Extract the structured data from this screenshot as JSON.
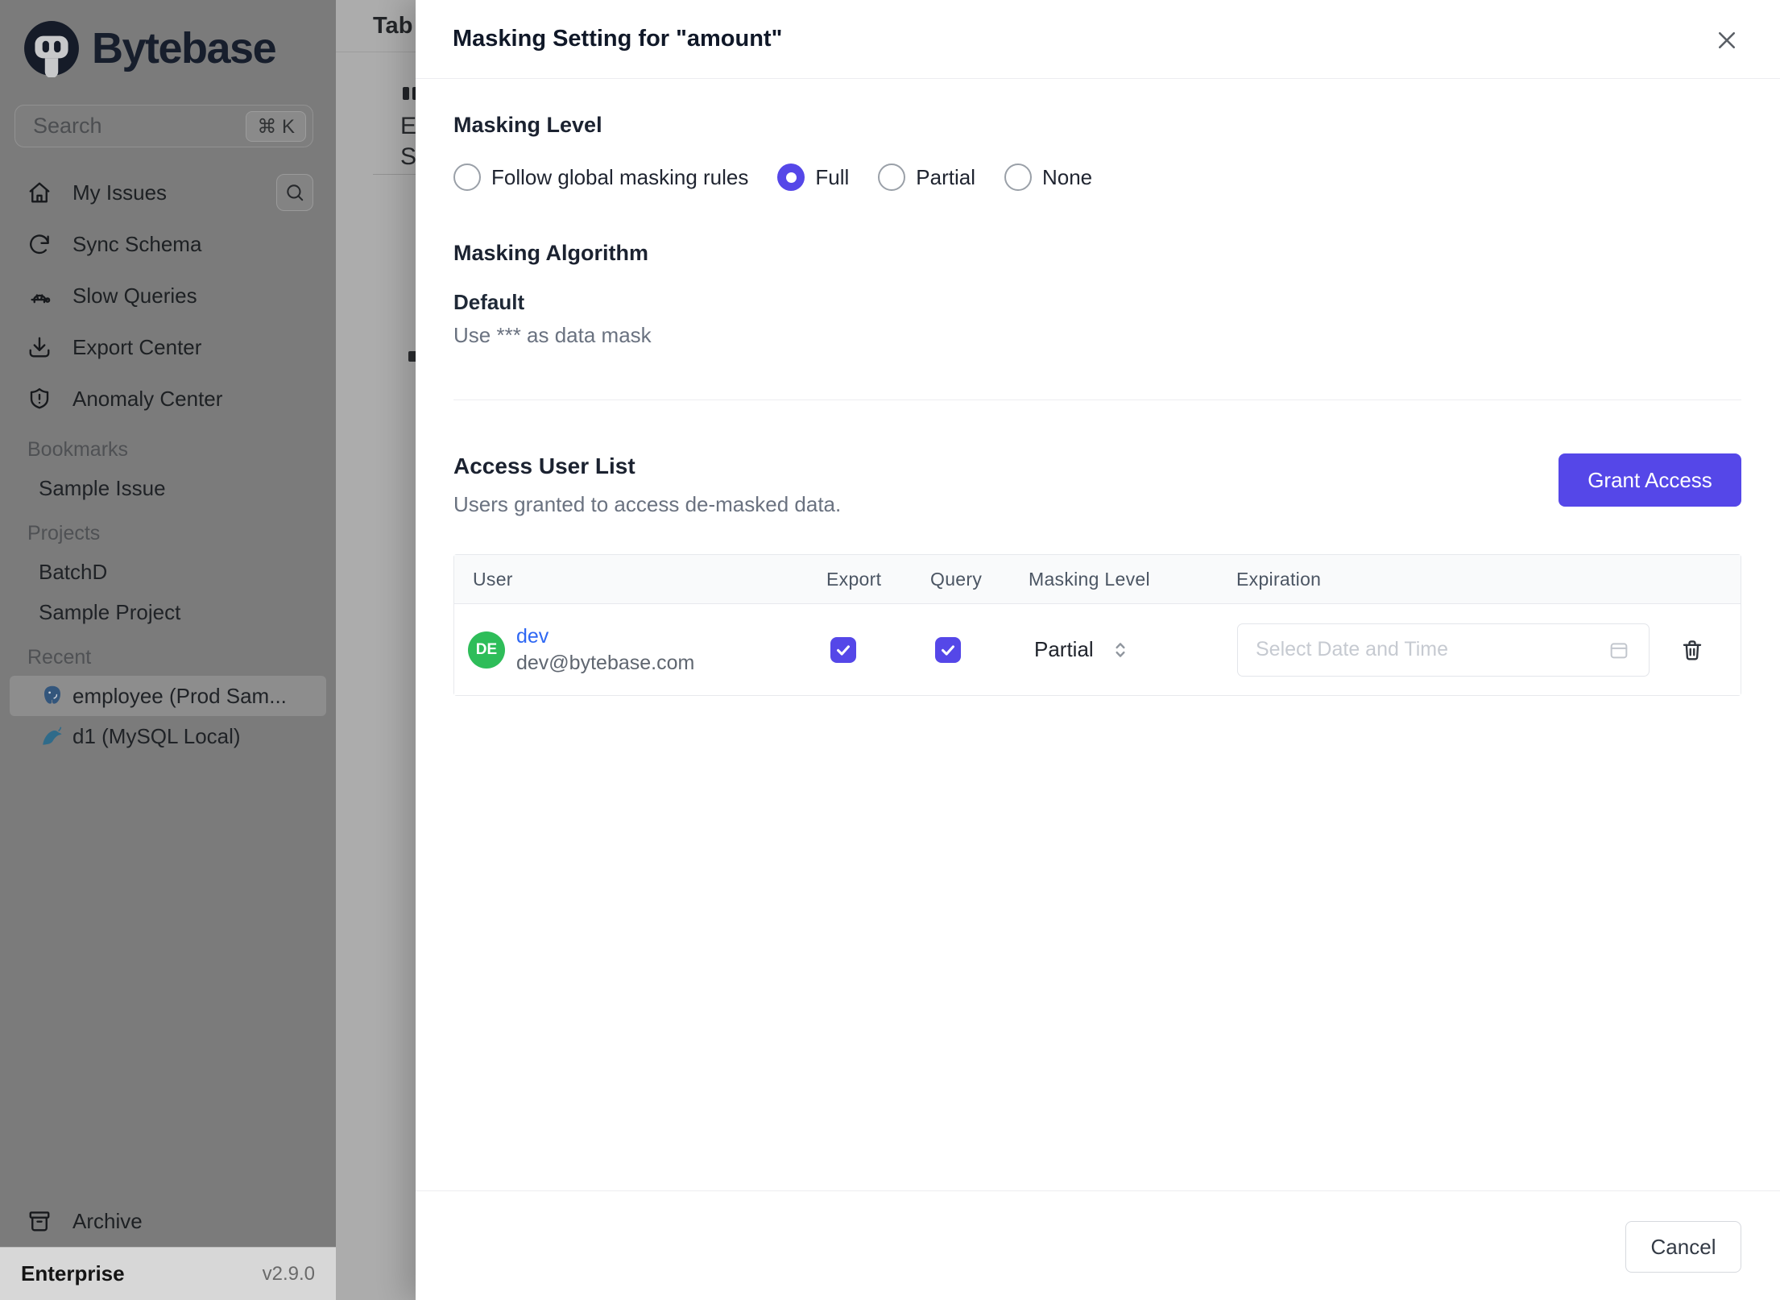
{
  "colors": {
    "accent": "#5547e8",
    "avatar_green": "#2ebd59",
    "link_blue": "#2e67f3"
  },
  "sidebar": {
    "logo_text": "Bytebase",
    "search": {
      "placeholder": "Search",
      "shortcut": "⌘ K"
    },
    "nav": [
      {
        "label": "My Issues"
      },
      {
        "label": "Sync Schema"
      },
      {
        "label": "Slow Queries"
      },
      {
        "label": "Export Center"
      },
      {
        "label": "Anomaly Center"
      }
    ],
    "bookmarks_label": "Bookmarks",
    "bookmarks": [
      {
        "label": "Sample Issue"
      }
    ],
    "projects_label": "Projects",
    "projects": [
      {
        "label": "BatchD"
      },
      {
        "label": "Sample Project"
      }
    ],
    "recent_label": "Recent",
    "recent": [
      {
        "label": "employee (Prod Sam...",
        "db": "postgres",
        "selected": true
      },
      {
        "label": "d1 (MySQL Local)",
        "db": "mysql",
        "selected": false
      }
    ],
    "archive_label": "Archive",
    "footer": {
      "plan": "Enterprise",
      "version": "v2.9.0"
    }
  },
  "page": {
    "tab_title": "Tab",
    "fragment_line1": "E",
    "fragment_line2": "S"
  },
  "modal": {
    "title": "Masking Setting for \"amount\"",
    "masking_level": {
      "heading": "Masking Level",
      "options": [
        {
          "label": "Follow global masking rules",
          "selected": false
        },
        {
          "label": "Full",
          "selected": true
        },
        {
          "label": "Partial",
          "selected": false
        },
        {
          "label": "None",
          "selected": false
        }
      ]
    },
    "masking_algorithm": {
      "heading": "Masking Algorithm",
      "name": "Default",
      "description": "Use *** as data mask"
    },
    "access_user_list": {
      "heading": "Access User List",
      "description": "Users granted to access de-masked data.",
      "grant_button": "Grant Access",
      "table": {
        "columns": [
          "User",
          "Export",
          "Query",
          "Masking Level",
          "Expiration"
        ],
        "rows": [
          {
            "initials": "DE",
            "name": "dev",
            "email": "dev@bytebase.com",
            "export_checked": true,
            "query_checked": true,
            "masking_level": "Partial",
            "expiration_placeholder": "Select Date and Time"
          }
        ]
      }
    },
    "cancel_button": "Cancel"
  }
}
